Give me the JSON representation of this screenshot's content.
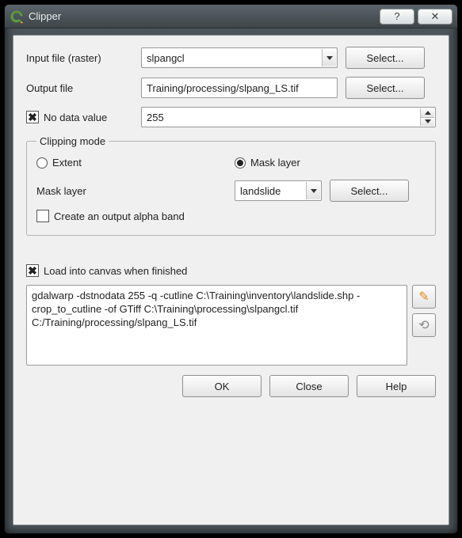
{
  "window": {
    "title": "Clipper"
  },
  "form": {
    "input_label": "Input file (raster)",
    "input_value": "slpangcl",
    "output_label": "Output file",
    "output_value": "Training/processing/slpang_LS.tif",
    "nodata_label": "No data value",
    "nodata_checked": true,
    "nodata_value": "255",
    "select_btn": "Select..."
  },
  "clip": {
    "legend": "Clipping mode",
    "extent_label": "Extent",
    "mask_label": "Mask layer",
    "selected": "mask",
    "mask_field_label": "Mask layer",
    "mask_value": "landslide",
    "select_btn": "Select...",
    "alpha_label": "Create an output alpha band",
    "alpha_checked": false
  },
  "load": {
    "label": "Load into canvas when finished",
    "checked": true
  },
  "command_text": "gdalwarp -dstnodata 255 -q -cutline C:\\Training\\inventory\\landslide.shp -crop_to_cutline -of GTiff C:\\Training\\processing\\slpangcl.tif C:/Training/processing/slpang_LS.tif",
  "buttons": {
    "ok": "OK",
    "close": "Close",
    "help": "Help"
  },
  "titlebar": {
    "help_glyph": "?",
    "close_glyph": "✕"
  }
}
